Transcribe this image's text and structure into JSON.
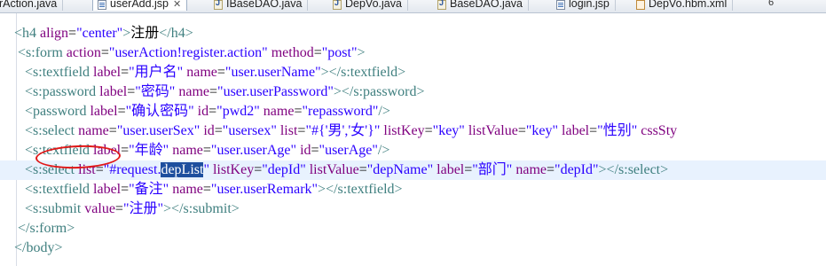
{
  "tabs": [
    {
      "label": "erAction.java",
      "icon": "java-file-icon"
    },
    {
      "label": "userAdd.jsp",
      "icon": "jsp-file-icon",
      "active": true,
      "close": "✕"
    },
    {
      "label": "IBaseDAO.java",
      "icon": "java-file-icon"
    },
    {
      "label": "DepVo.java",
      "icon": "java-file-icon"
    },
    {
      "label": "BaseDAO.java",
      "icon": "java-file-icon"
    },
    {
      "label": "login.jsp",
      "icon": "jsp-file-icon"
    },
    {
      "label": "DepVo.hbm.xml",
      "icon": "xml-file-icon"
    }
  ],
  "tab_overflow_count": "6",
  "code_lines": [
    {
      "indent": "  ",
      "parts": [
        [
          "tag",
          "<h4 "
        ],
        [
          "attr",
          "align"
        ],
        [
          "txt",
          "="
        ],
        [
          "val",
          "\"center\""
        ],
        [
          "tag",
          ">"
        ],
        [
          "txt",
          "注册"
        ],
        [
          "tag",
          "</h4>"
        ]
      ]
    },
    {
      "indent": "   ",
      "parts": [
        [
          "tag",
          "<s:form "
        ],
        [
          "attr",
          "action"
        ],
        [
          "txt",
          "="
        ],
        [
          "val",
          "\"userAction!register.action\""
        ],
        [
          "txt",
          " "
        ],
        [
          "attr",
          "method"
        ],
        [
          "txt",
          "="
        ],
        [
          "val",
          "\"post\""
        ],
        [
          "tag",
          ">"
        ]
      ]
    },
    {
      "indent": "     ",
      "parts": [
        [
          "tag",
          "<s:textfield "
        ],
        [
          "attr",
          "label"
        ],
        [
          "txt",
          "="
        ],
        [
          "val",
          "\"用户名\""
        ],
        [
          "txt",
          " "
        ],
        [
          "attr",
          "name"
        ],
        [
          "txt",
          "="
        ],
        [
          "val",
          "\"user.userName\""
        ],
        [
          "tag",
          "></s:textfield>"
        ]
      ]
    },
    {
      "indent": "     ",
      "parts": [
        [
          "tag",
          "<s:password "
        ],
        [
          "attr",
          "label"
        ],
        [
          "txt",
          "="
        ],
        [
          "val",
          "\"密码\""
        ],
        [
          "txt",
          " "
        ],
        [
          "attr",
          "name"
        ],
        [
          "txt",
          "="
        ],
        [
          "val",
          "\"user.userPassword\""
        ],
        [
          "tag",
          "></s:password>"
        ]
      ]
    },
    {
      "indent": "     ",
      "parts": [
        [
          "tag",
          "<password "
        ],
        [
          "attr",
          "label"
        ],
        [
          "txt",
          "="
        ],
        [
          "val",
          "\"确认密码\""
        ],
        [
          "txt",
          " "
        ],
        [
          "attr",
          "id"
        ],
        [
          "txt",
          "="
        ],
        [
          "val",
          "\"pwd2\""
        ],
        [
          "txt",
          " "
        ],
        [
          "attr",
          "name"
        ],
        [
          "txt",
          "="
        ],
        [
          "val",
          "\"repassword\""
        ],
        [
          "tag",
          "/>"
        ]
      ]
    },
    {
      "indent": "     ",
      "parts": [
        [
          "tag",
          "<s:select "
        ],
        [
          "attr",
          "name"
        ],
        [
          "txt",
          "="
        ],
        [
          "val",
          "\"user.userSex\""
        ],
        [
          "txt",
          " "
        ],
        [
          "attr",
          "id"
        ],
        [
          "txt",
          "="
        ],
        [
          "val",
          "\"usersex\""
        ],
        [
          "txt",
          " "
        ],
        [
          "attr",
          "list"
        ],
        [
          "txt",
          "="
        ],
        [
          "val",
          "\"#{'男','女'}\""
        ],
        [
          "txt",
          " "
        ],
        [
          "attr",
          "listKey"
        ],
        [
          "txt",
          "="
        ],
        [
          "val",
          "\"key\""
        ],
        [
          "txt",
          " "
        ],
        [
          "attr",
          "listValue"
        ],
        [
          "txt",
          "="
        ],
        [
          "val",
          "\"key\""
        ],
        [
          "txt",
          " "
        ],
        [
          "attr",
          "label"
        ],
        [
          "txt",
          "="
        ],
        [
          "val",
          "\"性别\""
        ],
        [
          "txt",
          " "
        ],
        [
          "attr",
          "cssSty"
        ]
      ]
    },
    {
      "indent": "     ",
      "parts": [
        [
          "tag",
          "<s:textfield "
        ],
        [
          "attr",
          "label"
        ],
        [
          "txt",
          "="
        ],
        [
          "val",
          "\"年龄\""
        ],
        [
          "txt",
          " "
        ],
        [
          "attr",
          "name"
        ],
        [
          "txt",
          "="
        ],
        [
          "val",
          "\"user.userAge\""
        ],
        [
          "txt",
          " "
        ],
        [
          "attr",
          "id"
        ],
        [
          "txt",
          "="
        ],
        [
          "val",
          "\"userAge\""
        ],
        [
          "tag",
          "/>"
        ]
      ]
    },
    {
      "indent": "     ",
      "current": true,
      "parts": [
        [
          "tag",
          "<s:select "
        ],
        [
          "attr",
          "list"
        ],
        [
          "txt",
          "="
        ],
        [
          "val",
          "\"#request."
        ],
        [
          "sel",
          "depList"
        ],
        [
          "val",
          "\""
        ],
        [
          "txt",
          " "
        ],
        [
          "attr",
          "listKey"
        ],
        [
          "txt",
          "="
        ],
        [
          "val",
          "\"depId\""
        ],
        [
          "txt",
          " "
        ],
        [
          "attr",
          "listValue"
        ],
        [
          "txt",
          "="
        ],
        [
          "val",
          "\"depName\""
        ],
        [
          "txt",
          " "
        ],
        [
          "attr",
          "label"
        ],
        [
          "txt",
          "="
        ],
        [
          "val",
          "\"部门\""
        ],
        [
          "txt",
          " "
        ],
        [
          "attr",
          "name"
        ],
        [
          "txt",
          "="
        ],
        [
          "val",
          "\"depId\""
        ],
        [
          "tag",
          "></s:select>"
        ]
      ]
    },
    {
      "indent": "     ",
      "parts": [
        [
          "tag",
          "<s:textfield "
        ],
        [
          "attr",
          "label"
        ],
        [
          "txt",
          "="
        ],
        [
          "val",
          "\"备注\""
        ],
        [
          "txt",
          " "
        ],
        [
          "attr",
          "name"
        ],
        [
          "txt",
          "="
        ],
        [
          "val",
          "\"user.userRemark\""
        ],
        [
          "tag",
          "></s:textfield>"
        ]
      ]
    },
    {
      "indent": "     ",
      "parts": [
        [
          "tag",
          "<s:submit "
        ],
        [
          "attr",
          "value"
        ],
        [
          "txt",
          "="
        ],
        [
          "val",
          "\"注册\""
        ],
        [
          "tag",
          "></s:submit>"
        ]
      ]
    },
    {
      "indent": "   ",
      "parts": [
        [
          "tag",
          "</s:form>"
        ]
      ]
    },
    {
      "indent": "  ",
      "parts": [
        [
          "tag",
          "</body>"
        ]
      ]
    }
  ],
  "colors": {
    "tag": "#3f7f7f",
    "attribute": "#7f007f",
    "value": "#2a00ff",
    "selection": "#1d4f9e",
    "current_line": "#e8f2fe",
    "annotation": "#e01818"
  }
}
